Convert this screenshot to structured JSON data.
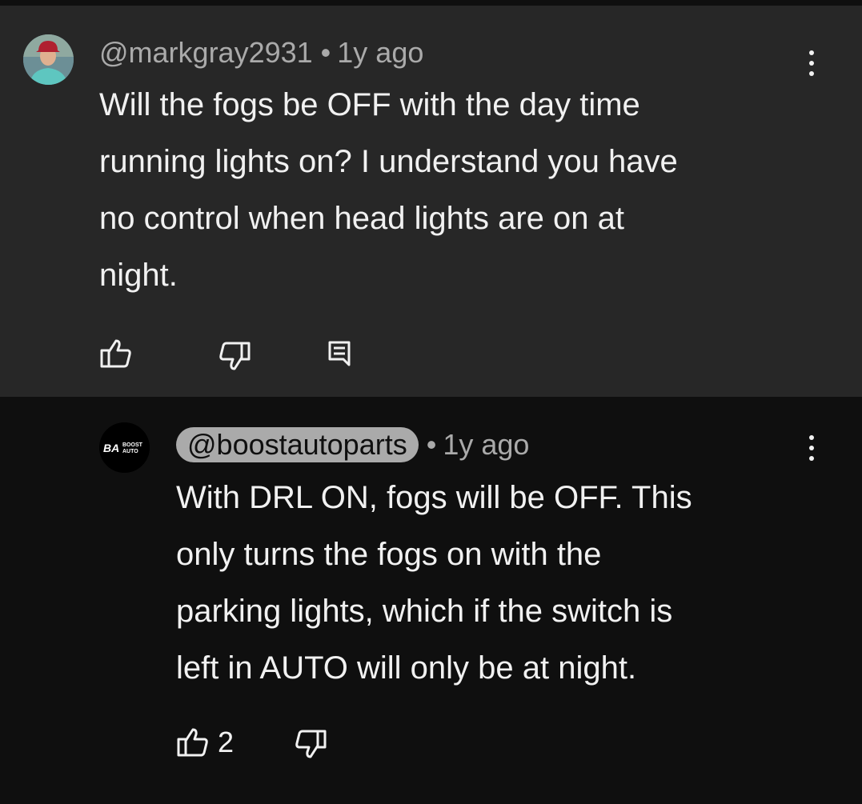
{
  "comment": {
    "author": "@markgray2931",
    "separator": "•",
    "time": "1y ago",
    "text": "Will the fogs be OFF with the day time\nrunning lights on?  I understand you have\nno control when head lights are on at\nnight.",
    "icons": {
      "avatar": "user-photo-avatar",
      "like": "thumbs-up-icon",
      "dislike": "thumbs-down-icon",
      "reply": "reply-comment-icon",
      "menu": "more-vertical-icon"
    }
  },
  "reply": {
    "author": "@boostautoparts",
    "separator": "•",
    "time": "1y ago",
    "text": "With DRL ON, fogs will be OFF. This\nonly turns the fogs on with the\nparking lights, which if the switch is\nleft in AUTO will only be at night.",
    "like_count": "2",
    "avatar_logo_text": "BA BOOST AUTO",
    "icons": {
      "avatar": "boost-auto-logo-avatar",
      "like": "thumbs-up-icon",
      "dislike": "thumbs-down-icon",
      "menu": "more-vertical-icon"
    }
  },
  "colors": {
    "comment_bg": "#272727",
    "page_bg": "#0f0f0f",
    "text": "#f1f1f1",
    "meta": "#aaaaaa"
  }
}
